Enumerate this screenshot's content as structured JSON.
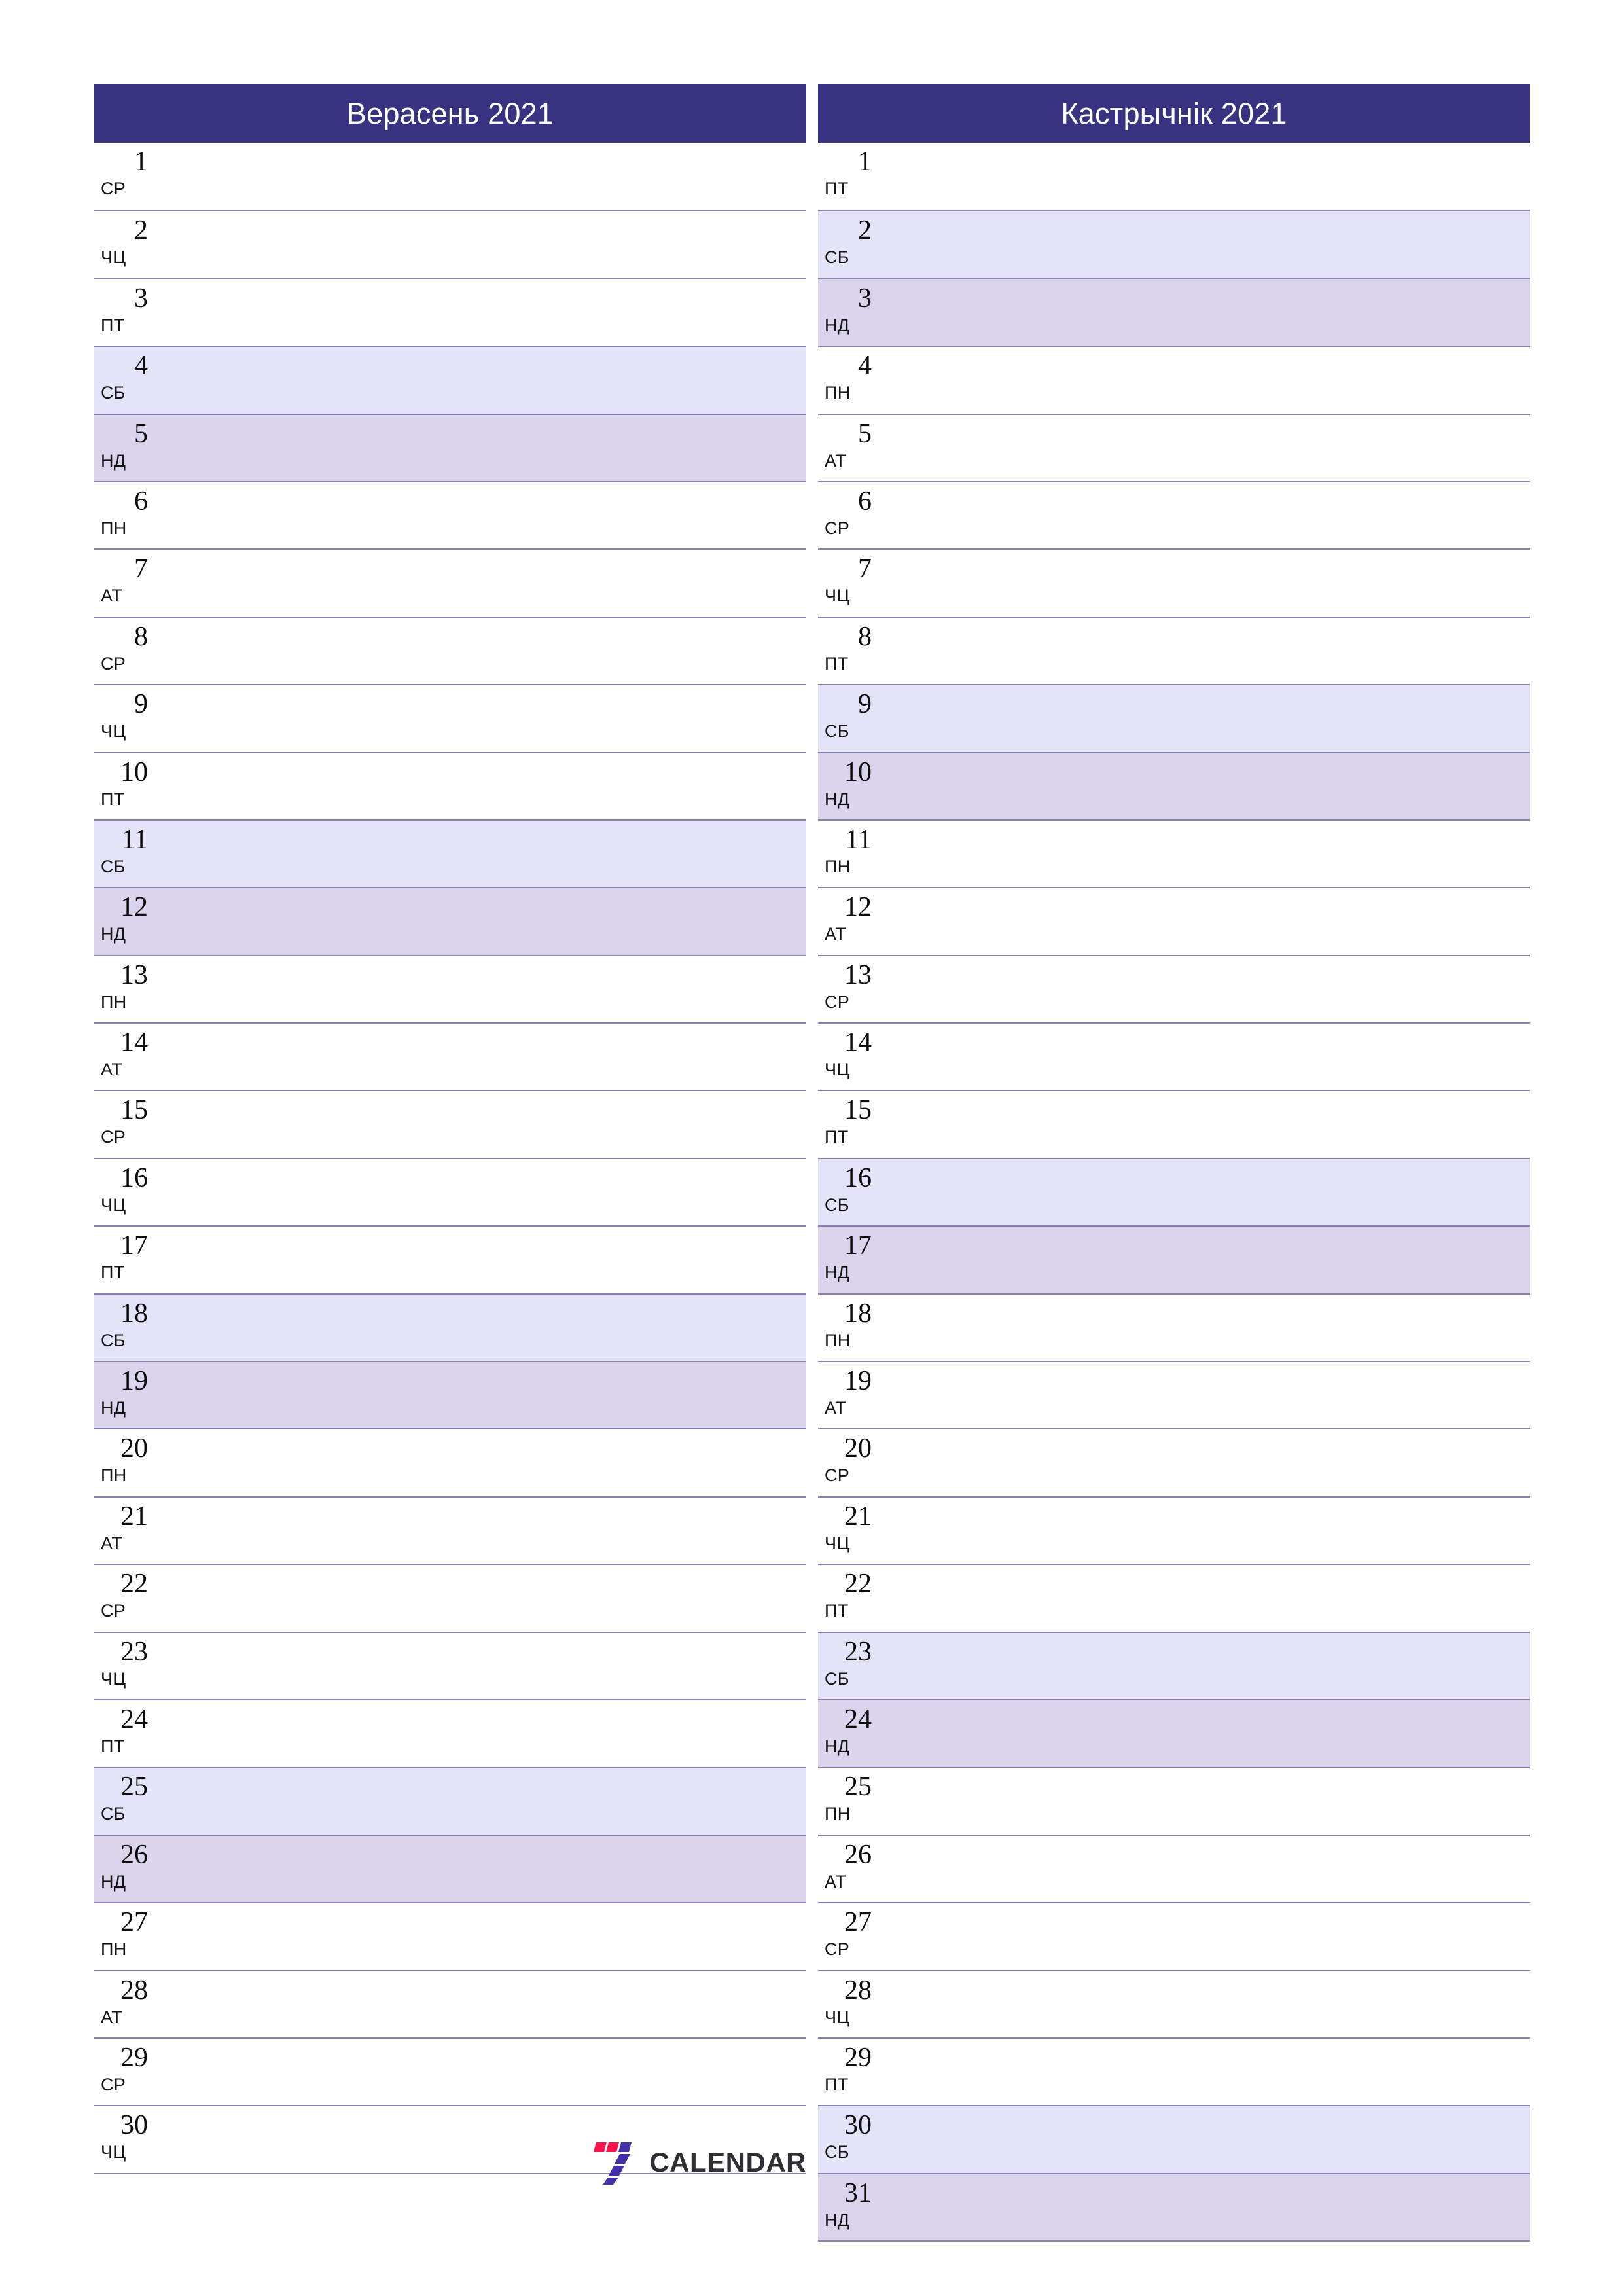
{
  "document": {
    "type": "monthly-planner",
    "year": "2021",
    "language": "be"
  },
  "colors": {
    "header_bg": "#383380",
    "header_text": "#ffffff",
    "row_line": "#8782b0",
    "saturday_bg": "#e4e3f8",
    "sunday_bg": "#dad5ec",
    "weekday_bg": "#ffffff",
    "logo_red": "#f5134a",
    "logo_purple": "#4430a8",
    "logo_word": "#2e2e33"
  },
  "brand": {
    "name": "CALENDAR",
    "mark": "seven-logo-icon"
  },
  "months": [
    {
      "title": "Верасень 2021",
      "name": "Верасень",
      "year": "2021",
      "days": [
        {
          "num": "1",
          "abbr": "СР",
          "kind": "weekday"
        },
        {
          "num": "2",
          "abbr": "ЧЦ",
          "kind": "weekday"
        },
        {
          "num": "3",
          "abbr": "ПТ",
          "kind": "weekday"
        },
        {
          "num": "4",
          "abbr": "СБ",
          "kind": "sat"
        },
        {
          "num": "5",
          "abbr": "НД",
          "kind": "sun"
        },
        {
          "num": "6",
          "abbr": "ПН",
          "kind": "weekday"
        },
        {
          "num": "7",
          "abbr": "АТ",
          "kind": "weekday"
        },
        {
          "num": "8",
          "abbr": "СР",
          "kind": "weekday"
        },
        {
          "num": "9",
          "abbr": "ЧЦ",
          "kind": "weekday"
        },
        {
          "num": "10",
          "abbr": "ПТ",
          "kind": "weekday"
        },
        {
          "num": "11",
          "abbr": "СБ",
          "kind": "sat"
        },
        {
          "num": "12",
          "abbr": "НД",
          "kind": "sun"
        },
        {
          "num": "13",
          "abbr": "ПН",
          "kind": "weekday"
        },
        {
          "num": "14",
          "abbr": "АТ",
          "kind": "weekday"
        },
        {
          "num": "15",
          "abbr": "СР",
          "kind": "weekday"
        },
        {
          "num": "16",
          "abbr": "ЧЦ",
          "kind": "weekday"
        },
        {
          "num": "17",
          "abbr": "ПТ",
          "kind": "weekday"
        },
        {
          "num": "18",
          "abbr": "СБ",
          "kind": "sat"
        },
        {
          "num": "19",
          "abbr": "НД",
          "kind": "sun"
        },
        {
          "num": "20",
          "abbr": "ПН",
          "kind": "weekday"
        },
        {
          "num": "21",
          "abbr": "АТ",
          "kind": "weekday"
        },
        {
          "num": "22",
          "abbr": "СР",
          "kind": "weekday"
        },
        {
          "num": "23",
          "abbr": "ЧЦ",
          "kind": "weekday"
        },
        {
          "num": "24",
          "abbr": "ПТ",
          "kind": "weekday"
        },
        {
          "num": "25",
          "abbr": "СБ",
          "kind": "sat"
        },
        {
          "num": "26",
          "abbr": "НД",
          "kind": "sun"
        },
        {
          "num": "27",
          "abbr": "ПН",
          "kind": "weekday"
        },
        {
          "num": "28",
          "abbr": "АТ",
          "kind": "weekday"
        },
        {
          "num": "29",
          "abbr": "СР",
          "kind": "weekday"
        },
        {
          "num": "30",
          "abbr": "ЧЦ",
          "kind": "weekday"
        }
      ]
    },
    {
      "title": "Кастрычнік 2021",
      "name": "Кастрычнік",
      "year": "2021",
      "days": [
        {
          "num": "1",
          "abbr": "ПТ",
          "kind": "weekday"
        },
        {
          "num": "2",
          "abbr": "СБ",
          "kind": "sat"
        },
        {
          "num": "3",
          "abbr": "НД",
          "kind": "sun"
        },
        {
          "num": "4",
          "abbr": "ПН",
          "kind": "weekday"
        },
        {
          "num": "5",
          "abbr": "АТ",
          "kind": "weekday"
        },
        {
          "num": "6",
          "abbr": "СР",
          "kind": "weekday"
        },
        {
          "num": "7",
          "abbr": "ЧЦ",
          "kind": "weekday"
        },
        {
          "num": "8",
          "abbr": "ПТ",
          "kind": "weekday"
        },
        {
          "num": "9",
          "abbr": "СБ",
          "kind": "sat"
        },
        {
          "num": "10",
          "abbr": "НД",
          "kind": "sun"
        },
        {
          "num": "11",
          "abbr": "ПН",
          "kind": "weekday"
        },
        {
          "num": "12",
          "abbr": "АТ",
          "kind": "weekday"
        },
        {
          "num": "13",
          "abbr": "СР",
          "kind": "weekday"
        },
        {
          "num": "14",
          "abbr": "ЧЦ",
          "kind": "weekday"
        },
        {
          "num": "15",
          "abbr": "ПТ",
          "kind": "weekday"
        },
        {
          "num": "16",
          "abbr": "СБ",
          "kind": "sat"
        },
        {
          "num": "17",
          "abbr": "НД",
          "kind": "sun"
        },
        {
          "num": "18",
          "abbr": "ПН",
          "kind": "weekday"
        },
        {
          "num": "19",
          "abbr": "АТ",
          "kind": "weekday"
        },
        {
          "num": "20",
          "abbr": "СР",
          "kind": "weekday"
        },
        {
          "num": "21",
          "abbr": "ЧЦ",
          "kind": "weekday"
        },
        {
          "num": "22",
          "abbr": "ПТ",
          "kind": "weekday"
        },
        {
          "num": "23",
          "abbr": "СБ",
          "kind": "sat"
        },
        {
          "num": "24",
          "abbr": "НД",
          "kind": "sun"
        },
        {
          "num": "25",
          "abbr": "ПН",
          "kind": "weekday"
        },
        {
          "num": "26",
          "abbr": "АТ",
          "kind": "weekday"
        },
        {
          "num": "27",
          "abbr": "СР",
          "kind": "weekday"
        },
        {
          "num": "28",
          "abbr": "ЧЦ",
          "kind": "weekday"
        },
        {
          "num": "29",
          "abbr": "ПТ",
          "kind": "weekday"
        },
        {
          "num": "30",
          "abbr": "СБ",
          "kind": "sat"
        },
        {
          "num": "31",
          "abbr": "НД",
          "kind": "sun"
        }
      ]
    }
  ]
}
